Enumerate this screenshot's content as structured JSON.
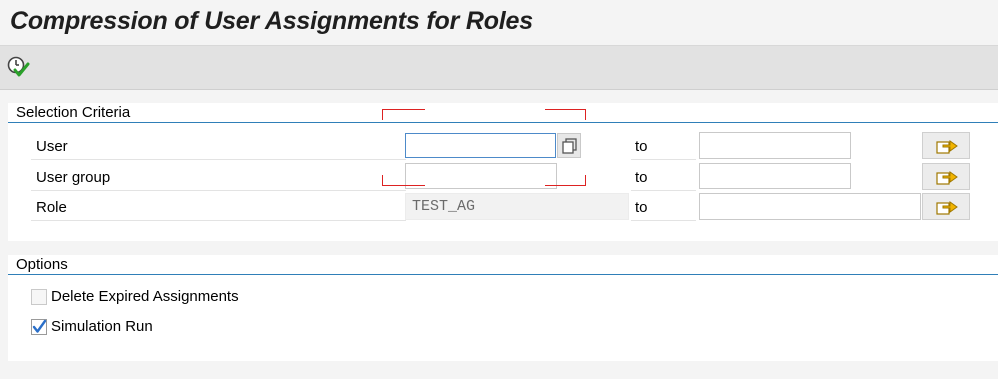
{
  "title": "Compression of User Assignments for Roles",
  "toolbar": {
    "execute_icon": "clock-check-icon"
  },
  "selection_criteria": {
    "header": "Selection Criteria",
    "to_label": "to",
    "rows": [
      {
        "label": "User",
        "from_value": "",
        "to_value": ""
      },
      {
        "label": "User group",
        "from_value": "",
        "to_value": ""
      },
      {
        "label": "Role",
        "from_value": "TEST_AG",
        "to_value": ""
      }
    ]
  },
  "options": {
    "header": "Options",
    "delete_expired": {
      "label": "Delete Expired Assignments",
      "checked": false
    },
    "simulation_run": {
      "label": "Simulation Run",
      "checked": true
    }
  },
  "colors": {
    "accent_blue": "#2f7fb8",
    "check_blue": "#2a6fc9",
    "annotation_red": "#dd2222",
    "arrow_yellow": "#f2b400"
  }
}
